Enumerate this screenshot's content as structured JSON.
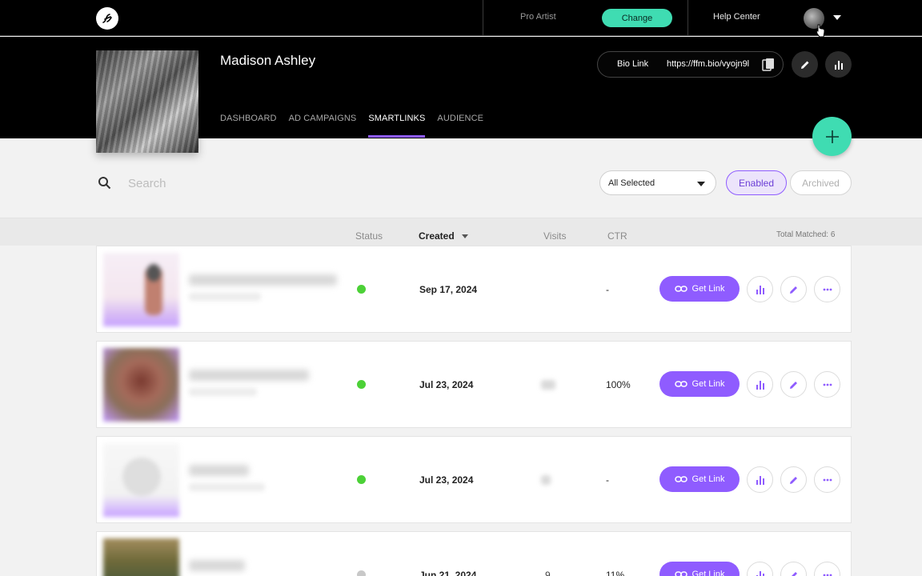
{
  "topbar": {
    "plan_label": "Pro Artist",
    "change_label": "Change",
    "help_label": "Help Center"
  },
  "artist": {
    "name": "Madison Ashley"
  },
  "bio": {
    "label": "Bio Link",
    "url": "https://ffm.bio/vyojn9l"
  },
  "nav": {
    "tabs": [
      "DASHBOARD",
      "AD CAMPAIGNS",
      "SMARTLINKS",
      "AUDIENCE"
    ],
    "active_tab": "SMARTLINKS"
  },
  "toolbar": {
    "search_placeholder": "Search",
    "filter_value": "All Selected",
    "enabled_label": "Enabled",
    "archived_label": "Archived"
  },
  "table": {
    "headers": {
      "status": "Status",
      "created": "Created",
      "visits": "Visits",
      "ctr": "CTR"
    },
    "total_matched": "Total Matched: 6",
    "rows": [
      {
        "created": "Sep 17, 2024",
        "visits": "",
        "ctr": "-",
        "status_color": "#4cd137",
        "get_link_label": "Get Link"
      },
      {
        "created": "Jul 23, 2024",
        "visits": "",
        "ctr": "100%",
        "status_color": "#4cd137",
        "get_link_label": "Get Link"
      },
      {
        "created": "Jul 23, 2024",
        "visits": "",
        "ctr": "-",
        "status_color": "#4cd137",
        "get_link_label": "Get Link"
      },
      {
        "created": "Jun 21, 2024",
        "visits": "9",
        "ctr": "11%",
        "status_color": "#c8c8c8",
        "get_link_label": "Get Link"
      }
    ]
  },
  "colors": {
    "accent_purple": "#8f5cff",
    "accent_teal": "#3fdcb2"
  }
}
